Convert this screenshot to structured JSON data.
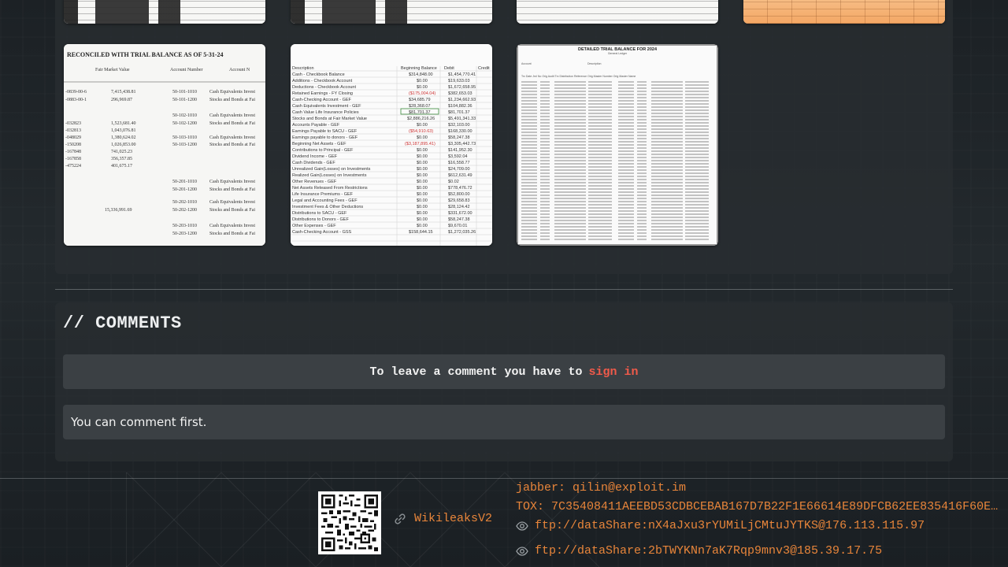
{
  "gallery": {
    "images": [
      {
        "alt": "Document page 1"
      },
      {
        "alt": "Document page 2"
      },
      {
        "alt": "Document page 3"
      },
      {
        "alt": "Spreadsheet page 4"
      },
      {
        "alt": "Reconciled with trial balance as of 5-31-24"
      },
      {
        "alt": "Trial balance spreadsheet"
      },
      {
        "alt": "Detailed trial balance for 2024"
      }
    ],
    "snippets": {
      "reconciled_header": "RECONCILED WITH TRIAL BALANCE AS OF 5-31-24",
      "detailed_header": "DETAILED TRIAL BALANCE FOR 2024"
    }
  },
  "comments": {
    "title": "// COMMENTS",
    "signin_prefix": "To leave a comment you have to",
    "signin_link": "sign in",
    "empty_text": "You can comment first."
  },
  "footer": {
    "wiki_label": "WikileaksV2",
    "jabber": "jabber: qilin@exploit.im",
    "tox": "TOX: 7C35408411AEEBD53CDBCEBAB167D7B22F1E66614E89DFCB62EE835416F60E1BC…",
    "ftp1": "ftp://dataShare:nX4aJxu3rYUMiLjCMtuJYTKS@176.113.115.97",
    "ftp2": "ftp://dataShare:2bTWYKNn7aK7Rqp9mnv3@185.39.17.75"
  },
  "colors": {
    "accent_orange": "#e8853a",
    "signin_red": "#f05a4a",
    "panel": "#282d31"
  },
  "icons": [
    "link-icon",
    "eye-icon",
    "qr-code"
  ]
}
